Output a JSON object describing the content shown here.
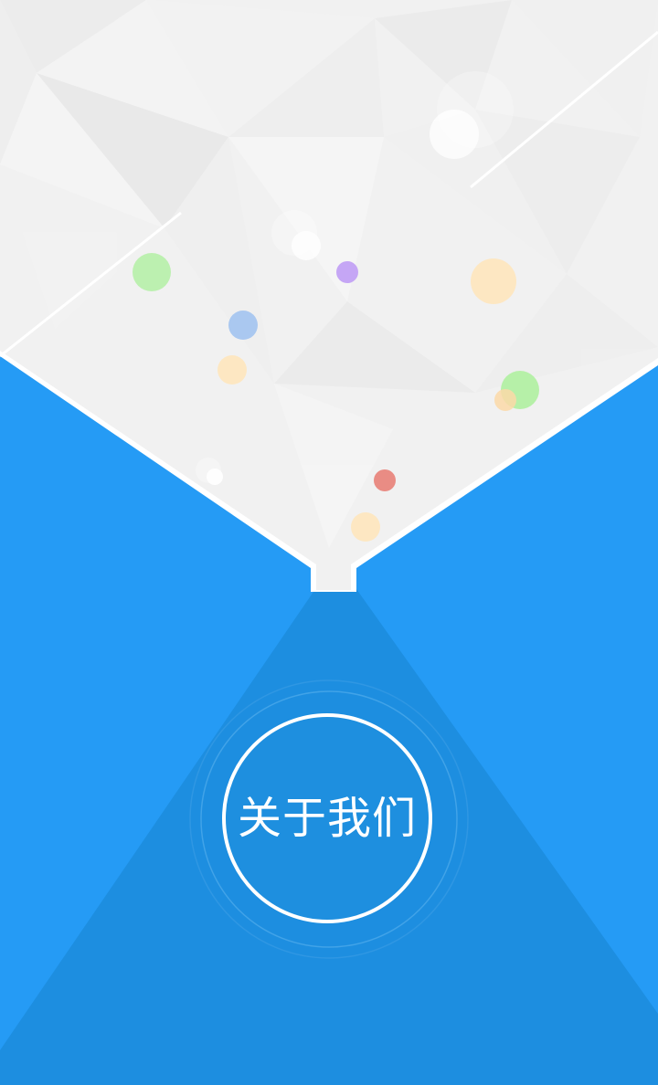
{
  "about": {
    "label": "关于我们"
  },
  "colors": {
    "primary_blue": "#259bf5",
    "beam_blue": "#1d8ee0",
    "paper_gray": "#f1f1f1",
    "line_white": "#ffffff"
  },
  "decorative_bubble_colors": [
    "#b6f0a8",
    "#aac8f0",
    "#c5a6f5",
    "#fde7c2",
    "#e98c84",
    "#f2f2f2"
  ]
}
